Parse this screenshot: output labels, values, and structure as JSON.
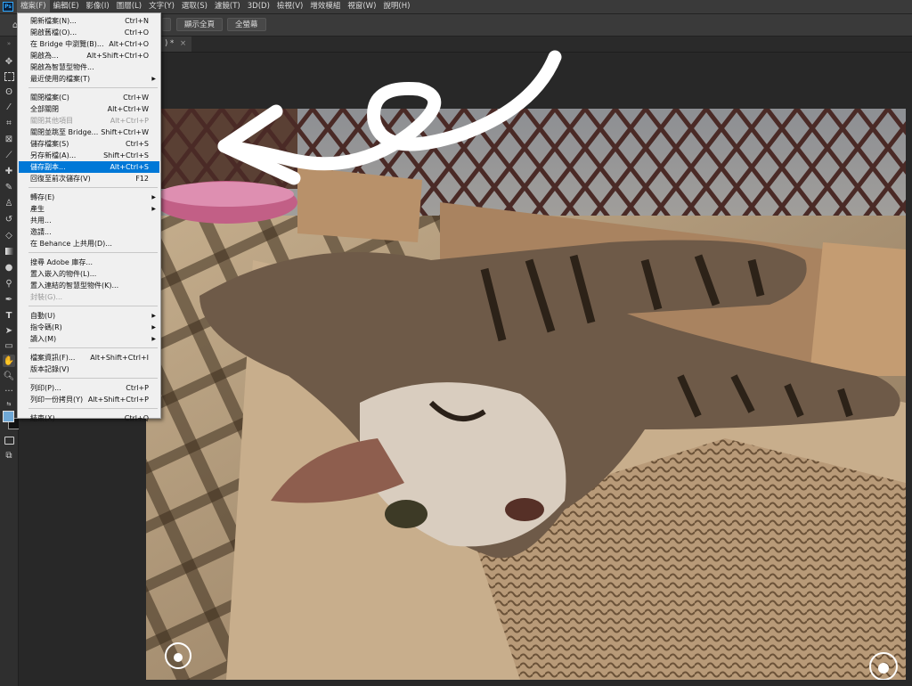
{
  "menubar": {
    "logo": "Ps",
    "items": [
      "檔案(F)",
      "編輯(E)",
      "影像(I)",
      "圖層(L)",
      "文字(Y)",
      "選取(S)",
      "濾鏡(T)",
      "3D(D)",
      "檢視(V)",
      "增效模組",
      "視窗(W)",
      "說明(H)"
    ]
  },
  "optionsbar": {
    "fit_screen": "顯示全頁",
    "fill_screen": "全螢幕"
  },
  "document_tab": {
    "title": ") *",
    "close": "×"
  },
  "file_menu": {
    "items": [
      {
        "label": "開新檔案(N)...",
        "shortcut": "Ctrl+N"
      },
      {
        "label": "開啟舊檔(O)...",
        "shortcut": "Ctrl+O"
      },
      {
        "label": "在 Bridge 中瀏覽(B)...",
        "shortcut": "Alt+Ctrl+O"
      },
      {
        "label": "開啟為...",
        "shortcut": "Alt+Shift+Ctrl+O"
      },
      {
        "label": "開啟為智慧型物件...",
        "shortcut": ""
      },
      {
        "label": "最近使用的檔案(T)",
        "shortcut": "",
        "submenu": true
      },
      {
        "label": "關閉檔案(C)",
        "shortcut": "Ctrl+W"
      },
      {
        "label": "全部關閉",
        "shortcut": "Alt+Ctrl+W"
      },
      {
        "label": "關閉其他項目",
        "shortcut": "Alt+Ctrl+P",
        "disabled": true
      },
      {
        "label": "關閉並跳至 Bridge...",
        "shortcut": "Shift+Ctrl+W"
      },
      {
        "label": "儲存檔案(S)",
        "shortcut": "Ctrl+S"
      },
      {
        "label": "另存新檔(A)...",
        "shortcut": "Shift+Ctrl+S"
      },
      {
        "label": "儲存副本...",
        "shortcut": "Alt+Ctrl+S",
        "highlighted": true
      },
      {
        "label": "回復至前次儲存(V)",
        "shortcut": "F12"
      },
      {
        "label": "轉存(E)",
        "shortcut": "",
        "submenu": true
      },
      {
        "label": "產生",
        "shortcut": "",
        "submenu": true
      },
      {
        "label": "共用...",
        "shortcut": ""
      },
      {
        "label": "邀請...",
        "shortcut": ""
      },
      {
        "label": "在 Behance 上共用(D)...",
        "shortcut": ""
      },
      {
        "label": "搜尋 Adobe 庫存...",
        "shortcut": ""
      },
      {
        "label": "置入嵌入的物件(L)...",
        "shortcut": ""
      },
      {
        "label": "置入連結的智慧型物件(K)...",
        "shortcut": ""
      },
      {
        "label": "封裝(G)...",
        "shortcut": "",
        "disabled": true
      },
      {
        "label": "自動(U)",
        "shortcut": "",
        "submenu": true
      },
      {
        "label": "指令碼(R)",
        "shortcut": "",
        "submenu": true
      },
      {
        "label": "讀入(M)",
        "shortcut": "",
        "submenu": true
      },
      {
        "label": "檔案資訊(F)...",
        "shortcut": "Alt+Shift+Ctrl+I"
      },
      {
        "label": "版本記錄(V)",
        "shortcut": ""
      },
      {
        "label": "列印(P)...",
        "shortcut": "Ctrl+P"
      },
      {
        "label": "列印一份拷貝(Y)",
        "shortcut": "Alt+Shift+Ctrl+P"
      },
      {
        "label": "結束(X)",
        "shortcut": "Ctrl+Q"
      }
    ]
  },
  "toolbar": {
    "tools": [
      "move-tool",
      "marquee-tool",
      "lasso-tool",
      "magic-wand-tool",
      "crop-tool",
      "frame-tool",
      "eyedropper-tool",
      "healing-tool",
      "brush-tool",
      "stamp-tool",
      "history-brush-tool",
      "eraser-tool",
      "gradient-tool",
      "blur-tool",
      "dodge-tool",
      "pen-tool",
      "type-tool",
      "path-select-tool",
      "rectangle-tool",
      "hand-tool",
      "zoom-tool",
      "more-tools"
    ],
    "foreground_color": "#6fa8d6",
    "background_color": "#111111"
  }
}
